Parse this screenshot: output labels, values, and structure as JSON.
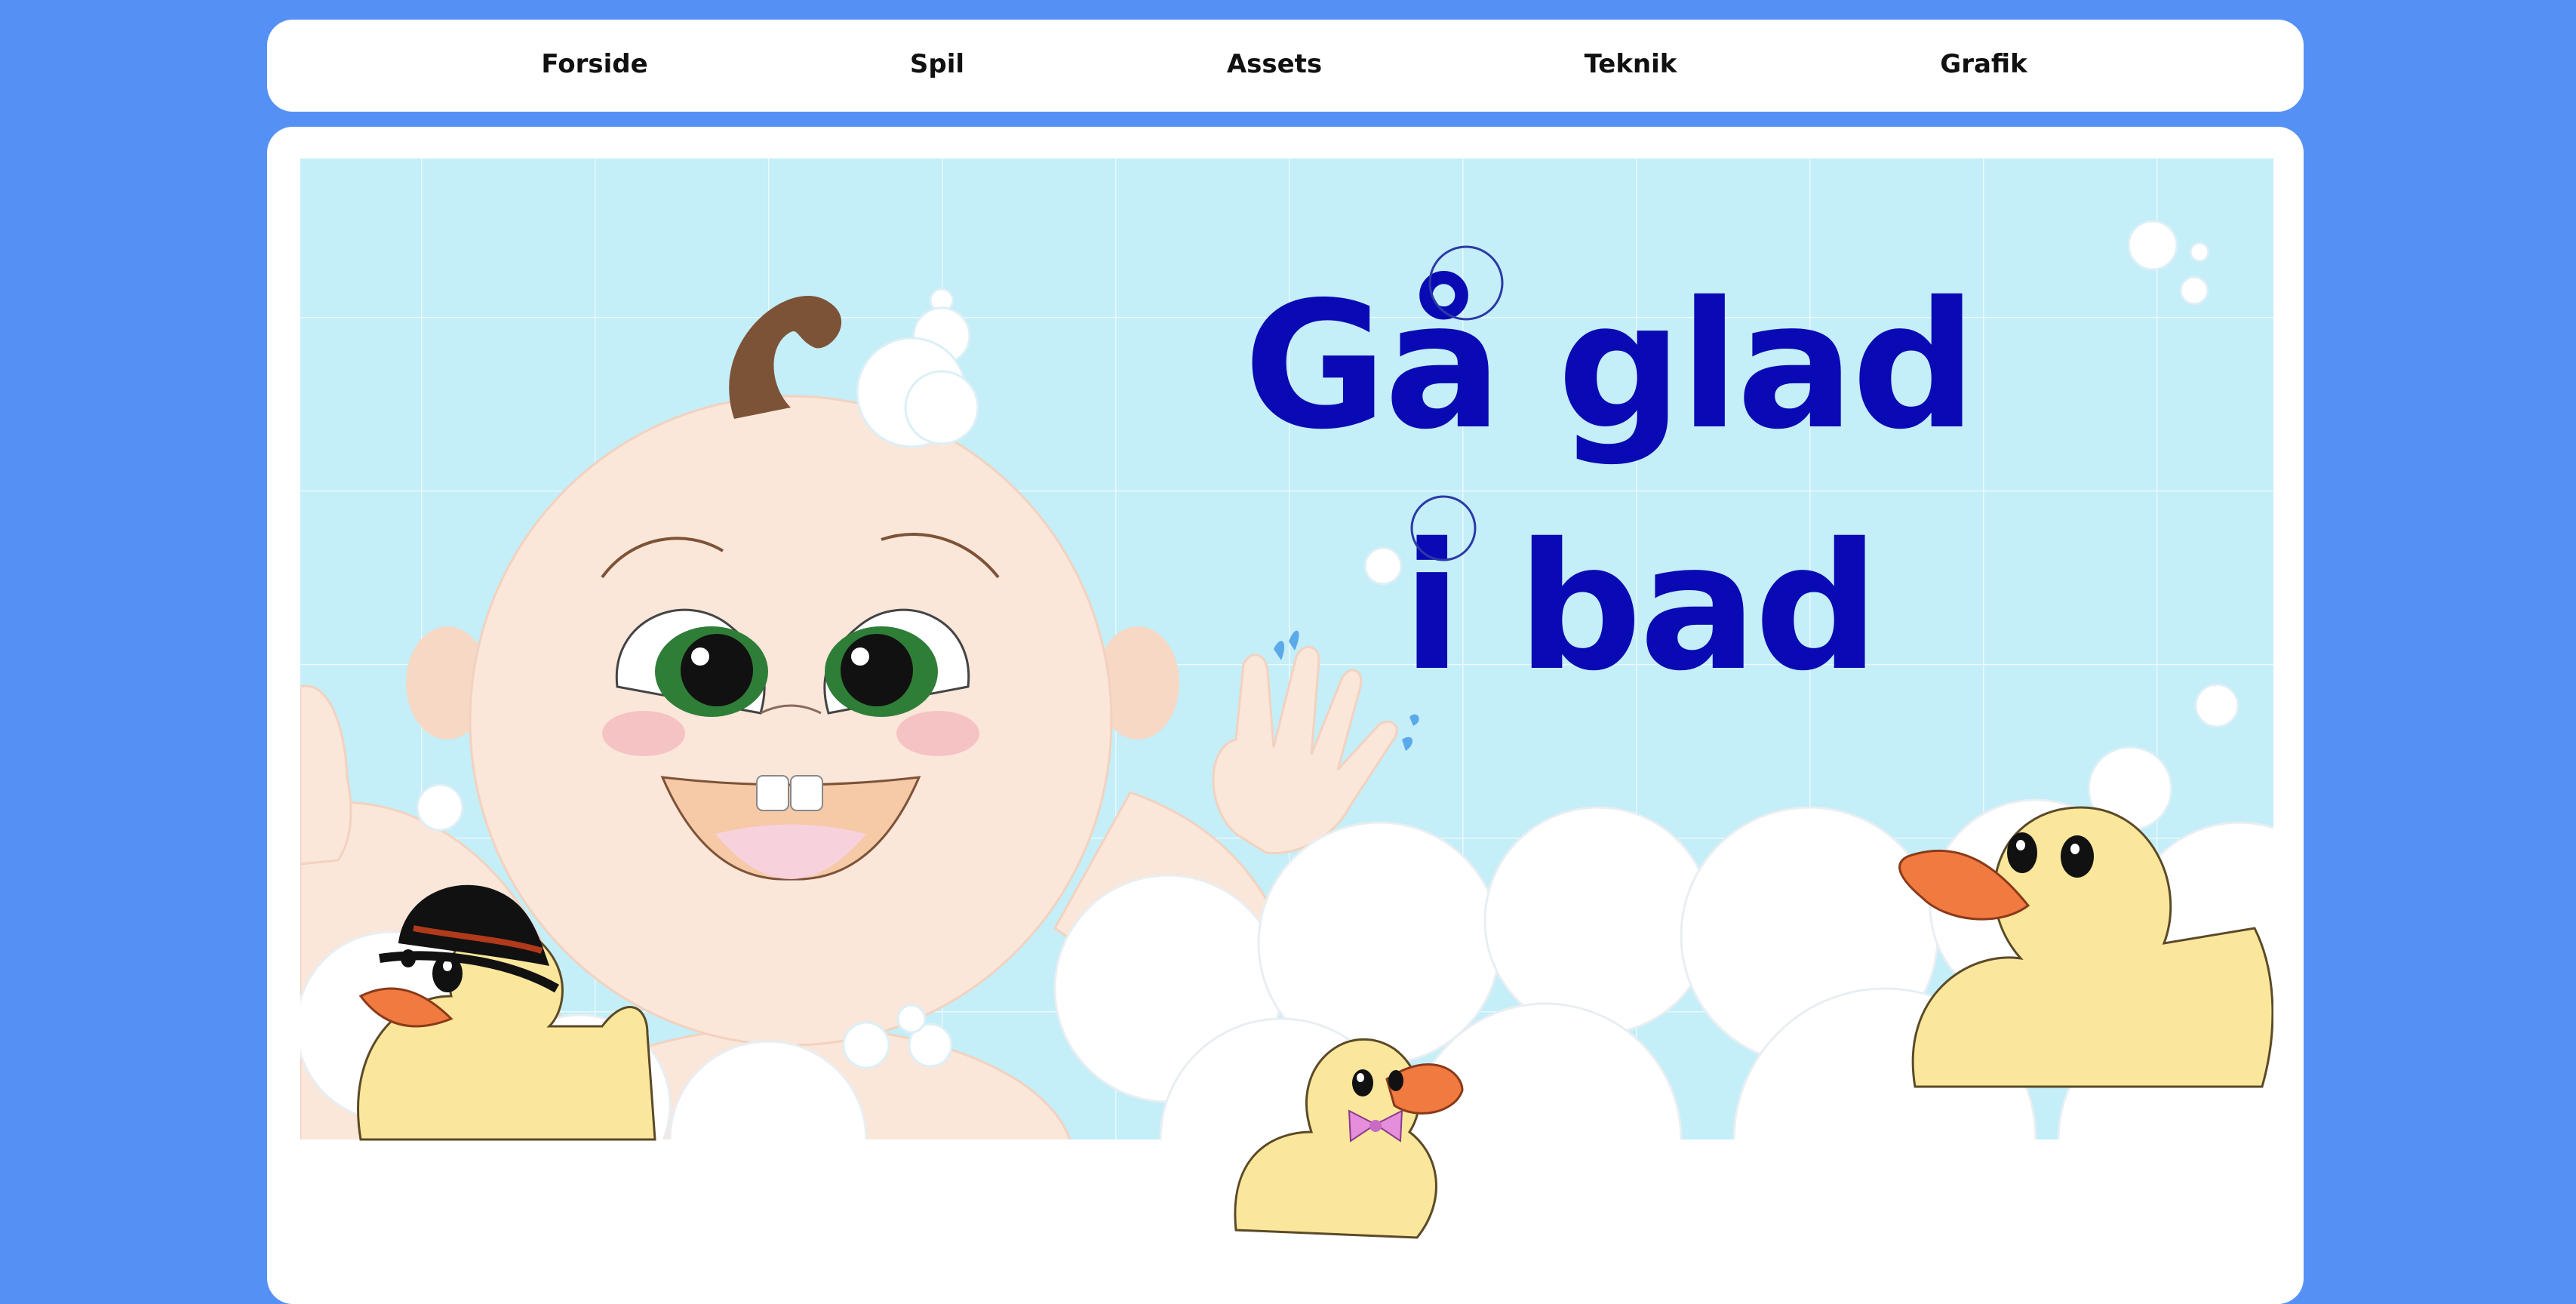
{
  "nav": {
    "items": [
      {
        "label": "Forside"
      },
      {
        "label": "Spil"
      },
      {
        "label": "Assets"
      },
      {
        "label": "Teknik"
      },
      {
        "label": "Grafik"
      }
    ]
  },
  "hero": {
    "title_line1": "Gå glad",
    "title_line2": "i bad",
    "colors": {
      "background": "#5591f5",
      "tile": "#c4eef8",
      "title": "#0a0ab4",
      "duck": "#fbe79c",
      "beak": "#f07a3f",
      "skin": "#fbe6da"
    }
  }
}
